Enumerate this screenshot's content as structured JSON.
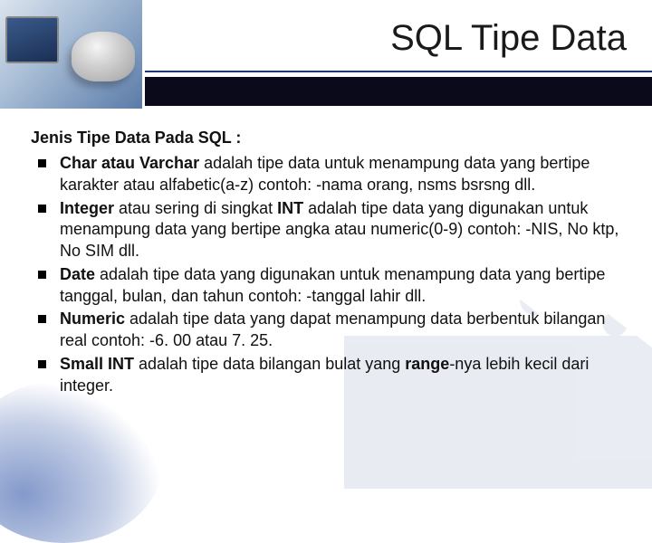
{
  "header": {
    "title": "SQL Tipe Data"
  },
  "content": {
    "subtitle": "Jenis Tipe Data Pada SQL :",
    "items": [
      {
        "lead": "Char atau Varchar",
        "rest": " adalah tipe data untuk menampung data yang bertipe karakter atau alfabetic(a-z) contoh: -nama orang, nsms bsrsng dll."
      },
      {
        "lead": "Integer",
        "mid1": " atau sering di singkat ",
        "mid_bold": "INT",
        "rest": " adalah tipe data yang digunakan untuk menampung data yang bertipe angka atau numeric(0-9) contoh: -NIS, No ktp, No SIM dll."
      },
      {
        "lead": "Date",
        "rest": " adalah tipe data yang digunakan untuk menampung data yang bertipe tanggal, bulan, dan tahun contoh: -tanggal lahir dll."
      },
      {
        "lead": "Numeric",
        "rest": " adalah tipe data yang dapat menampung data berbentuk bilangan real contoh: -6. 00 atau 7. 25."
      },
      {
        "lead": "Small INT",
        "mid1": " adalah tipe data bilangan bulat yang ",
        "mid_bold": "range",
        "rest": "-nya lebih kecil dari integer."
      }
    ]
  }
}
